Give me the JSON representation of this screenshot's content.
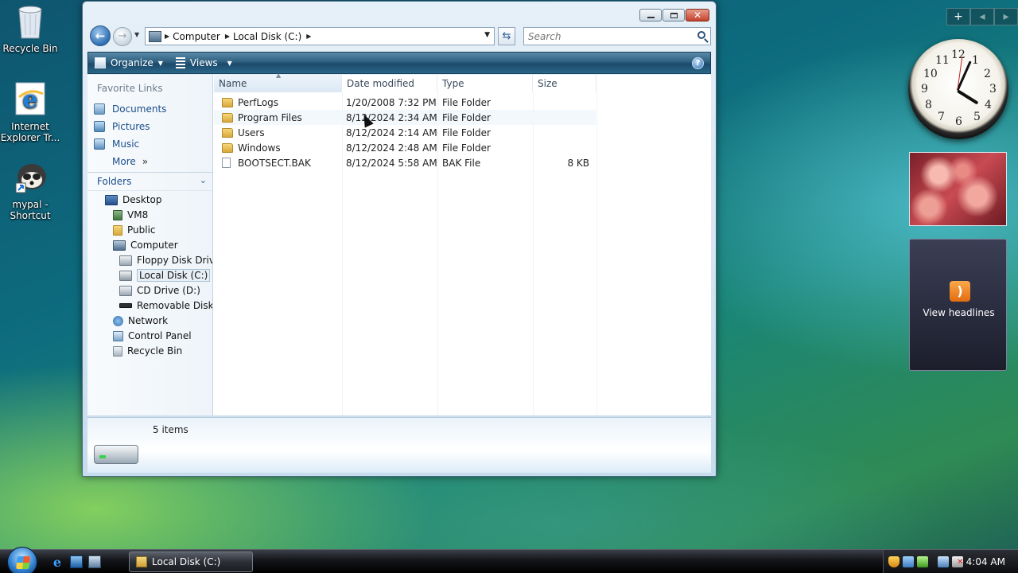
{
  "desktop": {
    "icons": [
      {
        "label": "Recycle Bin",
        "icon": "recycle-bin-icon"
      },
      {
        "label": "Internet Explorer Tr...",
        "icon": "internet-explorer-icon"
      },
      {
        "label": "mypal - Shortcut",
        "icon": "mypal-icon"
      }
    ]
  },
  "window": {
    "address": {
      "segments": [
        "Computer",
        "Local Disk (C:)"
      ]
    },
    "search": {
      "placeholder": "Search"
    },
    "toolbar": {
      "organize": "Organize",
      "views": "Views"
    },
    "nav_pane": {
      "favorites_title": "Favorite Links",
      "favorites": [
        "Documents",
        "Pictures",
        "Music",
        "More"
      ],
      "folders_title": "Folders",
      "tree": [
        "Desktop",
        "VM8",
        "Public",
        "Computer",
        "Floppy Disk Drive",
        "Local Disk (C:)",
        "CD Drive (D:)",
        "Removable Disk (E",
        "Network",
        "Control Panel",
        "Recycle Bin"
      ]
    },
    "columns": [
      "Name",
      "Date modified",
      "Type",
      "Size"
    ],
    "files": [
      {
        "name": "PerfLogs",
        "date": "1/20/2008 7:32 PM",
        "type": "File Folder",
        "size": "",
        "kind": "folder"
      },
      {
        "name": "Program Files",
        "date": "8/12/2024 2:34 AM",
        "type": "File Folder",
        "size": "",
        "kind": "folder"
      },
      {
        "name": "Users",
        "date": "8/12/2024 2:14 AM",
        "type": "File Folder",
        "size": "",
        "kind": "folder"
      },
      {
        "name": "Windows",
        "date": "8/12/2024 2:48 AM",
        "type": "File Folder",
        "size": "",
        "kind": "folder"
      },
      {
        "name": "BOOTSECT.BAK",
        "date": "8/12/2024 5:58 AM",
        "type": "BAK File",
        "size": "8 KB",
        "kind": "file"
      }
    ],
    "details": {
      "count": "5 items"
    }
  },
  "sidebar": {
    "controls": [
      "+",
      "◂",
      "▸"
    ],
    "clock_numbers": [
      "12",
      "1",
      "2",
      "3",
      "4",
      "5",
      "6",
      "7",
      "8",
      "9",
      "10",
      "11"
    ],
    "feed_text": "View headlines"
  },
  "taskbar": {
    "task_label": "Local Disk (C:)",
    "time": "4:04 AM"
  }
}
